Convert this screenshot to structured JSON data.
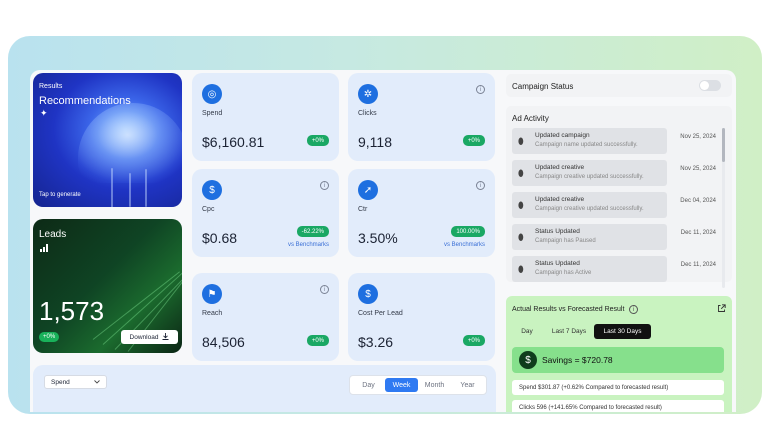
{
  "recommendations": {
    "label": "Results",
    "title": "Recommendations",
    "sparkle": "✦",
    "footer": "Tap to generate"
  },
  "leads": {
    "title": "Leads",
    "icon": "bar-chart-icon",
    "value": "1,573",
    "badge": "+0%",
    "download_label": "Download"
  },
  "metrics": {
    "spend": {
      "label": "Spend",
      "value": "$6,160.81",
      "badge": "+0%",
      "icon": "wallet-icon"
    },
    "clicks": {
      "label": "Clicks",
      "value": "9,118",
      "badge": "+0%",
      "icon": "cursor-click-icon"
    },
    "cpc": {
      "label": "Cpc",
      "value": "$0.68",
      "badge": "-62.22%",
      "bench": "vs Benchmarks",
      "icon": "cost-per-click-icon"
    },
    "ctr": {
      "label": "Ctr",
      "value": "3.50%",
      "badge": "100.00%",
      "bench": "vs Benchmarks",
      "icon": "cursor-icon"
    },
    "reach": {
      "label": "Reach",
      "value": "84,506",
      "badge": "+0%",
      "icon": "reach-icon"
    },
    "cpl": {
      "label": "Cost Per Lead",
      "value": "$3.26",
      "badge": "+0%",
      "icon": "dollar-icon"
    }
  },
  "filter": {
    "metric_select": "Spend",
    "periods": [
      "Day",
      "Week",
      "Month",
      "Year"
    ],
    "active_period": "Week"
  },
  "campaign_status": {
    "title": "Campaign Status"
  },
  "ad_activity": {
    "title": "Ad Activity",
    "items": [
      {
        "title": "Updated campaign",
        "desc": "Campaign name updated successfully.",
        "date": "Nov 25, 2024"
      },
      {
        "title": "Updated creative",
        "desc": "Campaign creative updated successfully.",
        "date": "Nov 25, 2024"
      },
      {
        "title": "Updated creative",
        "desc": "Campaign creative updated successfully.",
        "date": "Dec 04, 2024"
      },
      {
        "title": "Status Updated",
        "desc": "Campaign has Paused",
        "date": "Dec 11, 2024"
      },
      {
        "title": "Status Updated",
        "desc": "Campaign has Active",
        "date": "Dec 11, 2024"
      }
    ]
  },
  "results": {
    "title": "Actual Results vs Forecasted Result",
    "tabs": [
      "Day",
      "Last 7 Days",
      "Last 30 Days"
    ],
    "active_tab": "Last 30 Days",
    "savings": "Savings = $720.78",
    "lines": [
      "Spend $301.87 (+0.62% Compared to forecasted result)",
      "Clicks 596 (+141.65% Compared to forecasted result)"
    ]
  },
  "colors": {
    "accent": "#2f7af2",
    "positive": "#1aa864",
    "metric_card": "#e2ecfb",
    "results_panel": "#c9f3c0"
  }
}
